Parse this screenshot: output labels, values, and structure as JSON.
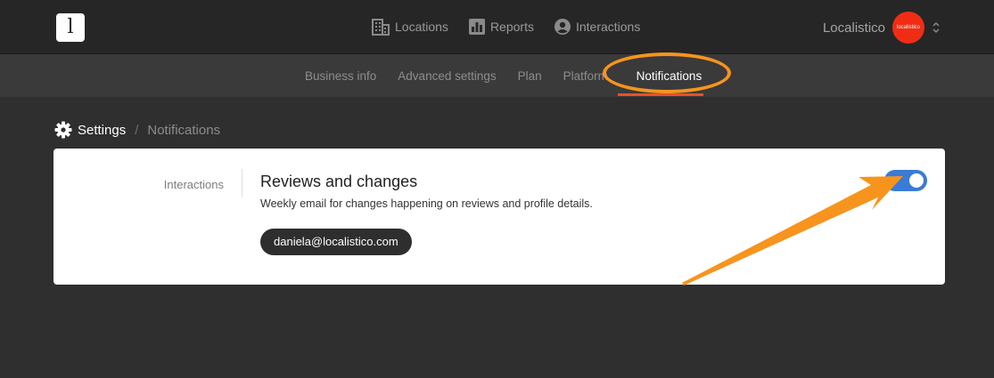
{
  "logo": {
    "letter": "l"
  },
  "topnav": {
    "items": [
      {
        "label": "Locations",
        "icon": "building-icon"
      },
      {
        "label": "Reports",
        "icon": "bar-chart-icon"
      },
      {
        "label": "Interactions",
        "icon": "user-icon"
      }
    ]
  },
  "account": {
    "name": "Localistico",
    "avatar_text": "localistico",
    "avatar_color": "#f02d14"
  },
  "subnav": {
    "items": [
      {
        "label": "Business info"
      },
      {
        "label": "Advanced settings"
      },
      {
        "label": "Plan"
      },
      {
        "label": "Platforms"
      },
      {
        "label": "Notifications",
        "active": true
      }
    ]
  },
  "breadcrumb": {
    "root": "Settings",
    "separator": "/",
    "page": "Notifications"
  },
  "notifications": {
    "section_label": "Interactions",
    "title": "Reviews and changes",
    "description": "Weekly email for changes happening on reviews and profile details.",
    "email": "daniela@localistico.com",
    "enabled": true
  },
  "colors": {
    "toggle_on": "#3a7bd5",
    "annotation": "#f7941d",
    "active_underline": "#e8502b"
  }
}
